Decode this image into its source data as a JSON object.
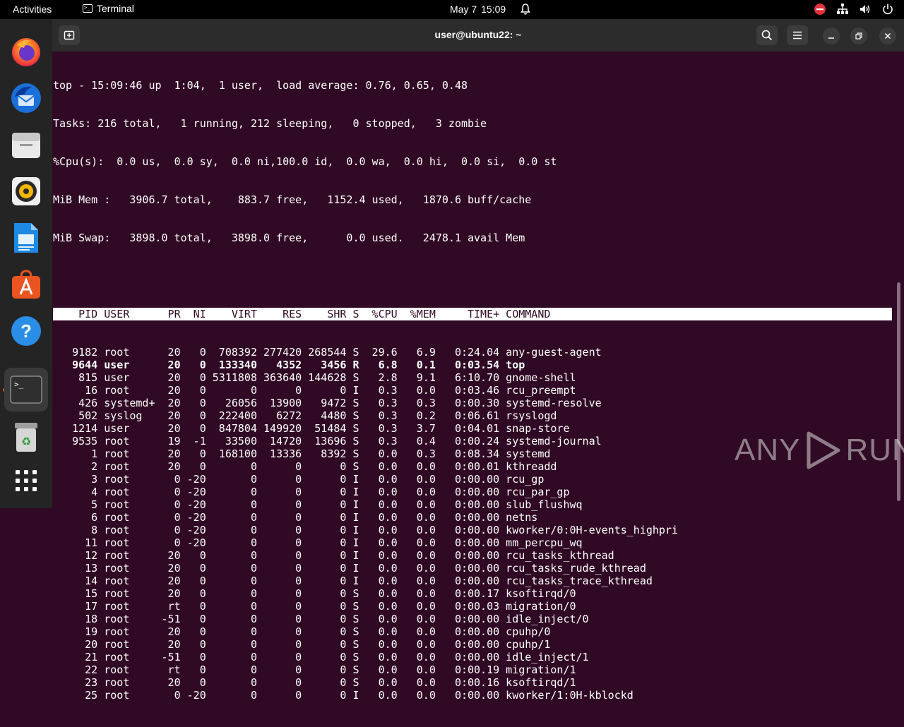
{
  "topbar": {
    "activities": "Activities",
    "app_name": "Terminal",
    "date": "May 7",
    "time": "15:09"
  },
  "dock": {
    "items": [
      "firefox-icon",
      "thunderbird-icon",
      "files-icon",
      "rhythmbox-icon",
      "writer-icon",
      "software-icon",
      "help-icon",
      "terminal-icon",
      "trash-icon",
      "apps-grid-icon"
    ]
  },
  "window": {
    "title": "user@ubuntu22: ~"
  },
  "top": {
    "summary": [
      "top - 15:09:46 up  1:04,  1 user,  load average: 0.76, 0.65, 0.48",
      "Tasks: 216 total,   1 running, 212 sleeping,   0 stopped,   3 zombie",
      "%Cpu(s):  0.0 us,  0.0 sy,  0.0 ni,100.0 id,  0.0 wa,  0.0 hi,  0.0 si,  0.0 st",
      "MiB Mem :   3906.7 total,    883.7 free,   1152.4 used,   1870.6 buff/cache",
      "MiB Swap:   3898.0 total,   3898.0 free,      0.0 used.   2478.1 avail Mem"
    ],
    "header": "    PID USER      PR  NI    VIRT    RES    SHR S  %CPU  %MEM     TIME+ COMMAND                                                ",
    "rows": [
      {
        "text": "   9182 root      20   0  708392 277420 268544 S  29.6   6.9   0:24.04 any-guest-agent",
        "bold": false
      },
      {
        "text": "   9644 user      20   0  133340   4352   3456 R   6.8   0.1   0:03.54 top",
        "bold": true
      },
      {
        "text": "    815 user      20   0 5311808 363640 144628 S   2.8   9.1   6:10.70 gnome-shell",
        "bold": false
      },
      {
        "text": "     16 root      20   0       0      0      0 I   0.3   0.0   0:03.46 rcu_preempt",
        "bold": false
      },
      {
        "text": "    426 systemd+  20   0   26056  13900   9472 S   0.3   0.3   0:00.30 systemd-resolve",
        "bold": false
      },
      {
        "text": "    502 syslog    20   0  222400   6272   4480 S   0.3   0.2   0:06.61 rsyslogd",
        "bold": false
      },
      {
        "text": "   1214 user      20   0  847804 149920  51484 S   0.3   3.7   0:04.01 snap-store",
        "bold": false
      },
      {
        "text": "   9535 root      19  -1   33500  14720  13696 S   0.3   0.4   0:00.24 systemd-journal",
        "bold": false
      },
      {
        "text": "      1 root      20   0  168100  13336   8392 S   0.0   0.3   0:08.34 systemd",
        "bold": false
      },
      {
        "text": "      2 root      20   0       0      0      0 S   0.0   0.0   0:00.01 kthreadd",
        "bold": false
      },
      {
        "text": "      3 root       0 -20       0      0      0 I   0.0   0.0   0:00.00 rcu_gp",
        "bold": false
      },
      {
        "text": "      4 root       0 -20       0      0      0 I   0.0   0.0   0:00.00 rcu_par_gp",
        "bold": false
      },
      {
        "text": "      5 root       0 -20       0      0      0 I   0.0   0.0   0:00.00 slub_flushwq",
        "bold": false
      },
      {
        "text": "      6 root       0 -20       0      0      0 I   0.0   0.0   0:00.00 netns",
        "bold": false
      },
      {
        "text": "      8 root       0 -20       0      0      0 I   0.0   0.0   0:00.00 kworker/0:0H-events_highpri",
        "bold": false
      },
      {
        "text": "     11 root       0 -20       0      0      0 I   0.0   0.0   0:00.00 mm_percpu_wq",
        "bold": false
      },
      {
        "text": "     12 root      20   0       0      0      0 I   0.0   0.0   0:00.00 rcu_tasks_kthread",
        "bold": false
      },
      {
        "text": "     13 root      20   0       0      0      0 I   0.0   0.0   0:00.00 rcu_tasks_rude_kthread",
        "bold": false
      },
      {
        "text": "     14 root      20   0       0      0      0 I   0.0   0.0   0:00.00 rcu_tasks_trace_kthread",
        "bold": false
      },
      {
        "text": "     15 root      20   0       0      0      0 S   0.0   0.0   0:00.17 ksoftirqd/0",
        "bold": false
      },
      {
        "text": "     17 root      rt   0       0      0      0 S   0.0   0.0   0:00.03 migration/0",
        "bold": false
      },
      {
        "text": "     18 root     -51   0       0      0      0 S   0.0   0.0   0:00.00 idle_inject/0",
        "bold": false
      },
      {
        "text": "     19 root      20   0       0      0      0 S   0.0   0.0   0:00.00 cpuhp/0",
        "bold": false
      },
      {
        "text": "     20 root      20   0       0      0      0 S   0.0   0.0   0:00.00 cpuhp/1",
        "bold": false
      },
      {
        "text": "     21 root     -51   0       0      0      0 S   0.0   0.0   0:00.00 idle_inject/1",
        "bold": false
      },
      {
        "text": "     22 root      rt   0       0      0      0 S   0.0   0.0   0:00.19 migration/1",
        "bold": false
      },
      {
        "text": "     23 root      20   0       0      0      0 S   0.0   0.0   0:00.16 ksoftirqd/1",
        "bold": false
      },
      {
        "text": "     25 root       0 -20       0      0      0 I   0.0   0.0   0:00.00 kworker/1:0H-kblockd",
        "bold": false
      }
    ]
  },
  "watermark": {
    "left": "ANY",
    "right": "RUN"
  }
}
